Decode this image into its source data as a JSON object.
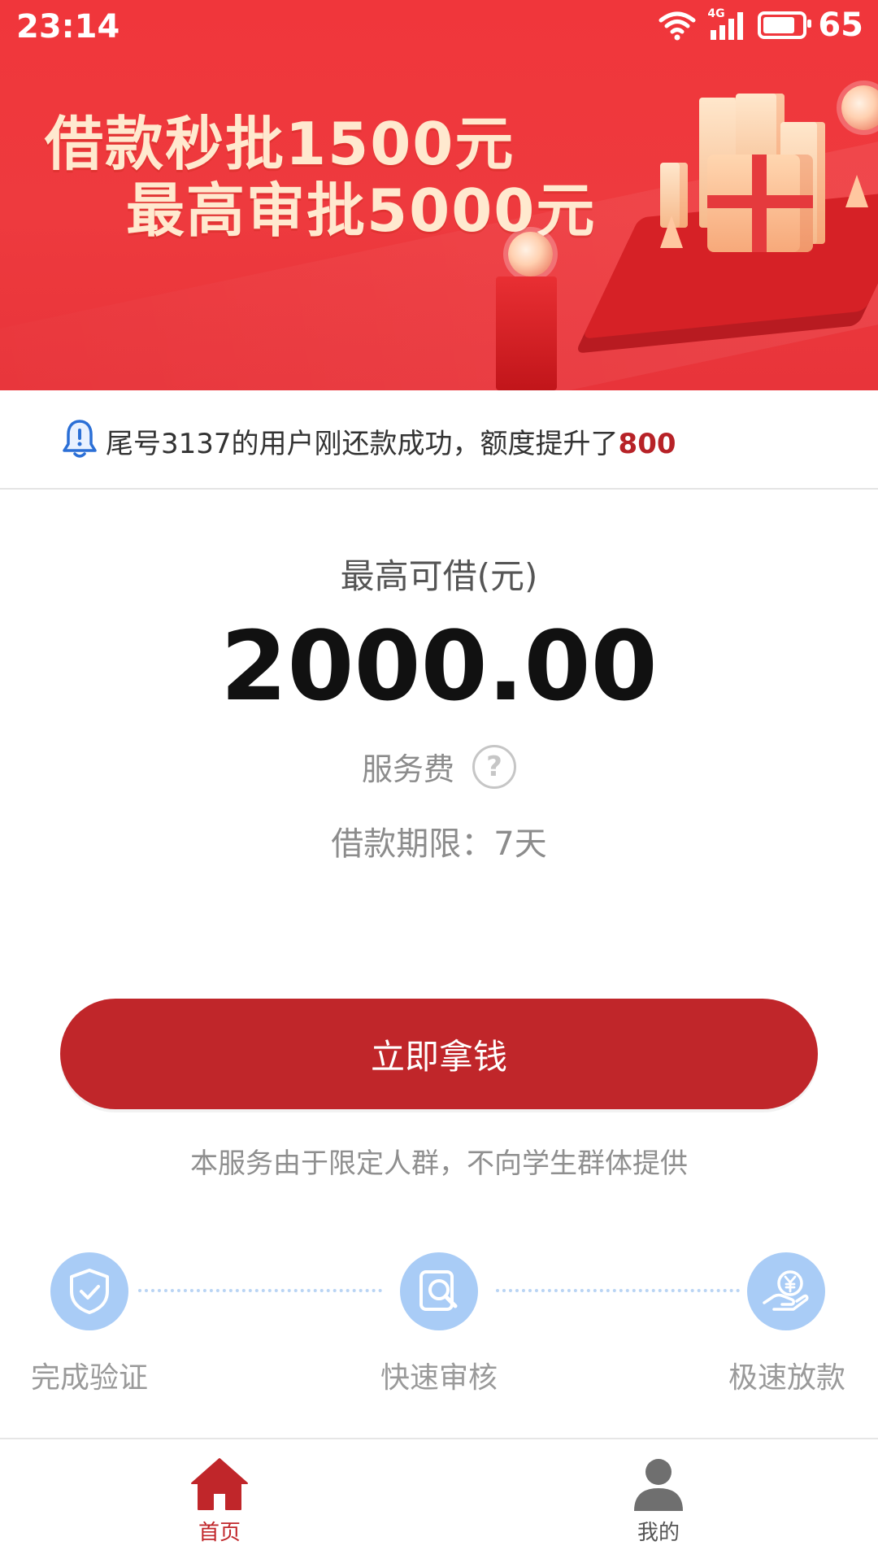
{
  "status_bar": {
    "time": "23:14",
    "network": "4G",
    "battery": "65"
  },
  "banner": {
    "line1": "借款秒批1500元",
    "line2": "最高审批5000元",
    "colors": {
      "background": "#ee3a3e",
      "text": "#ffe9cf"
    }
  },
  "notice": {
    "icon": "bell-icon",
    "text": "尾号3137的用户刚还款成功，额度提升了",
    "highlight": "800"
  },
  "loan": {
    "max_label": "最高可借(元)",
    "amount": "2000.00",
    "fee_label": "服务费",
    "fee_icon": "question-circle-icon",
    "term": "借款期限：7天"
  },
  "cta": {
    "label": "立即拿钱",
    "color": "#c0262a"
  },
  "disclaimer": "本服务由于限定人群，不向学生群体提供",
  "steps": [
    {
      "label": "完成验证",
      "icon": "shield-check-icon"
    },
    {
      "label": "快速审核",
      "icon": "magnify-doc-icon"
    },
    {
      "label": "极速放款",
      "icon": "yen-hand-icon"
    }
  ],
  "nav": {
    "items": [
      {
        "label": "首页",
        "icon": "home-icon",
        "active": true
      },
      {
        "label": "我的",
        "icon": "user-icon",
        "active": false
      }
    ],
    "active_color": "#c0262a",
    "inactive_color": "#555555"
  }
}
